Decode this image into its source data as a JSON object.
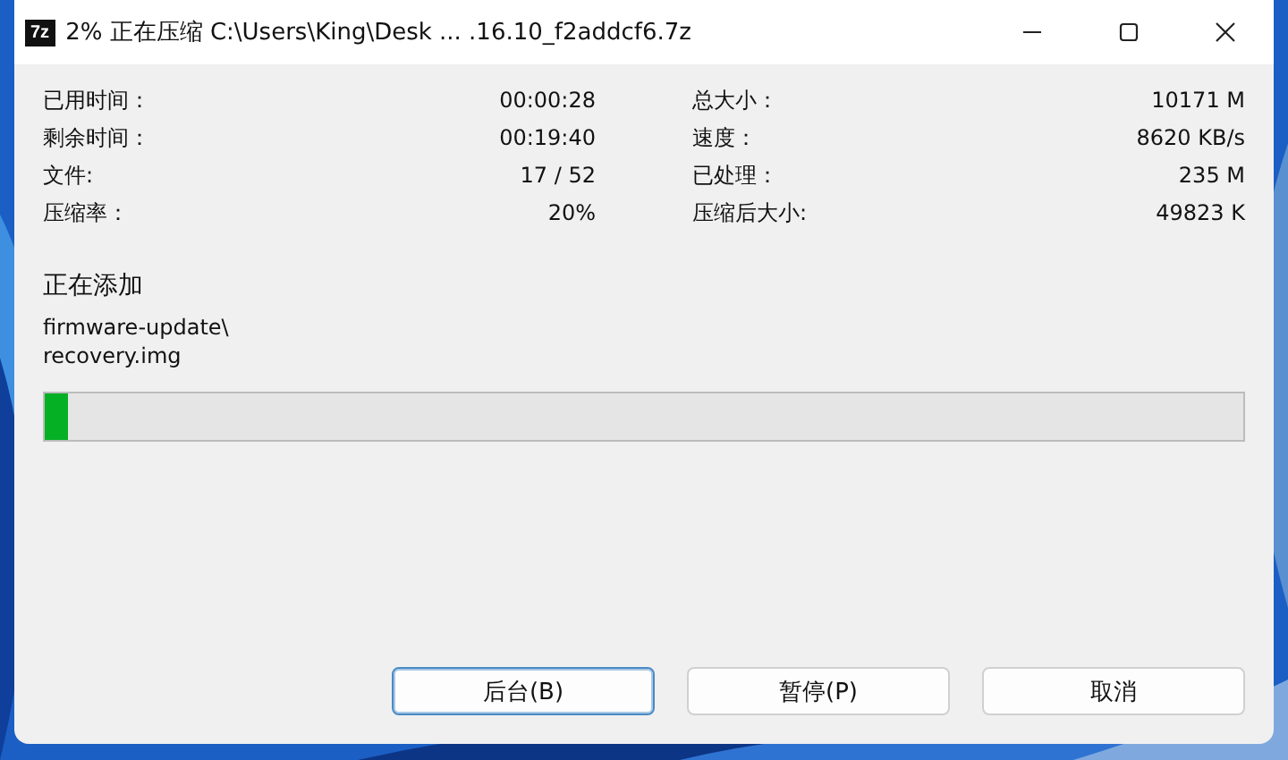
{
  "window": {
    "icon_text": "7z",
    "title": "2% 正在压缩 C:\\Users\\King\\Desk ... .16.10_f2addcf6.7z"
  },
  "stats_left": [
    {
      "label": "已用时间：",
      "value": "00:00:28"
    },
    {
      "label": "剩余时间：",
      "value": "00:19:40"
    },
    {
      "label": "文件:",
      "value": "17 / 52"
    },
    {
      "label": "压缩率：",
      "value": "20%"
    }
  ],
  "stats_right": [
    {
      "label": "总大小：",
      "value": "10171 M"
    },
    {
      "label": "速度：",
      "value": "8620 KB/s"
    },
    {
      "label": "已处理：",
      "value": "235 M"
    },
    {
      "label": "压缩后大小:",
      "value": "49823 K"
    }
  ],
  "current": {
    "heading": "正在添加",
    "lines": [
      "firmware-update\\",
      "recovery.img"
    ]
  },
  "progress": {
    "level": 0.02
  },
  "buttons": [
    {
      "label": "后台(B)",
      "focused": true
    },
    {
      "label": "暂停(P)",
      "focused": false
    },
    {
      "label": "取消",
      "focused": false
    }
  ]
}
